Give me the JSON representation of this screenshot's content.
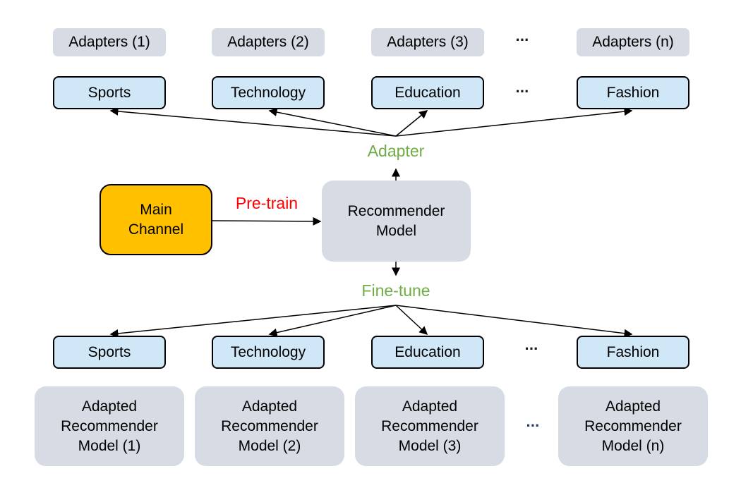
{
  "adapters": [
    "Adapters (1)",
    "Adapters (2)",
    "Adapters (3)",
    "Adapters (n)"
  ],
  "top_domains": [
    "Sports",
    "Technology",
    "Education",
    "Fashion"
  ],
  "bottom_domains": [
    "Sports",
    "Technology",
    "Education",
    "Fashion"
  ],
  "adapted_models": [
    "Adapted Recommender Model (1)",
    "Adapted Recommender Model (2)",
    "Adapted Recommender Model (3)",
    "Adapted Recommender Model (n)"
  ],
  "main_channel": "Main Channel",
  "recommender": "Recommender Model",
  "pretrain": "Pre-train",
  "adapter_label": "Adapter",
  "finetune": "Fine-tune",
  "ellipsis": "···",
  "colors": {
    "main_channel": "#ffc000",
    "domain": "#cfe7f7",
    "gray": "#d6dbe4",
    "pretrain": "#ff0000",
    "adapter_finetune": "#70ad47"
  }
}
